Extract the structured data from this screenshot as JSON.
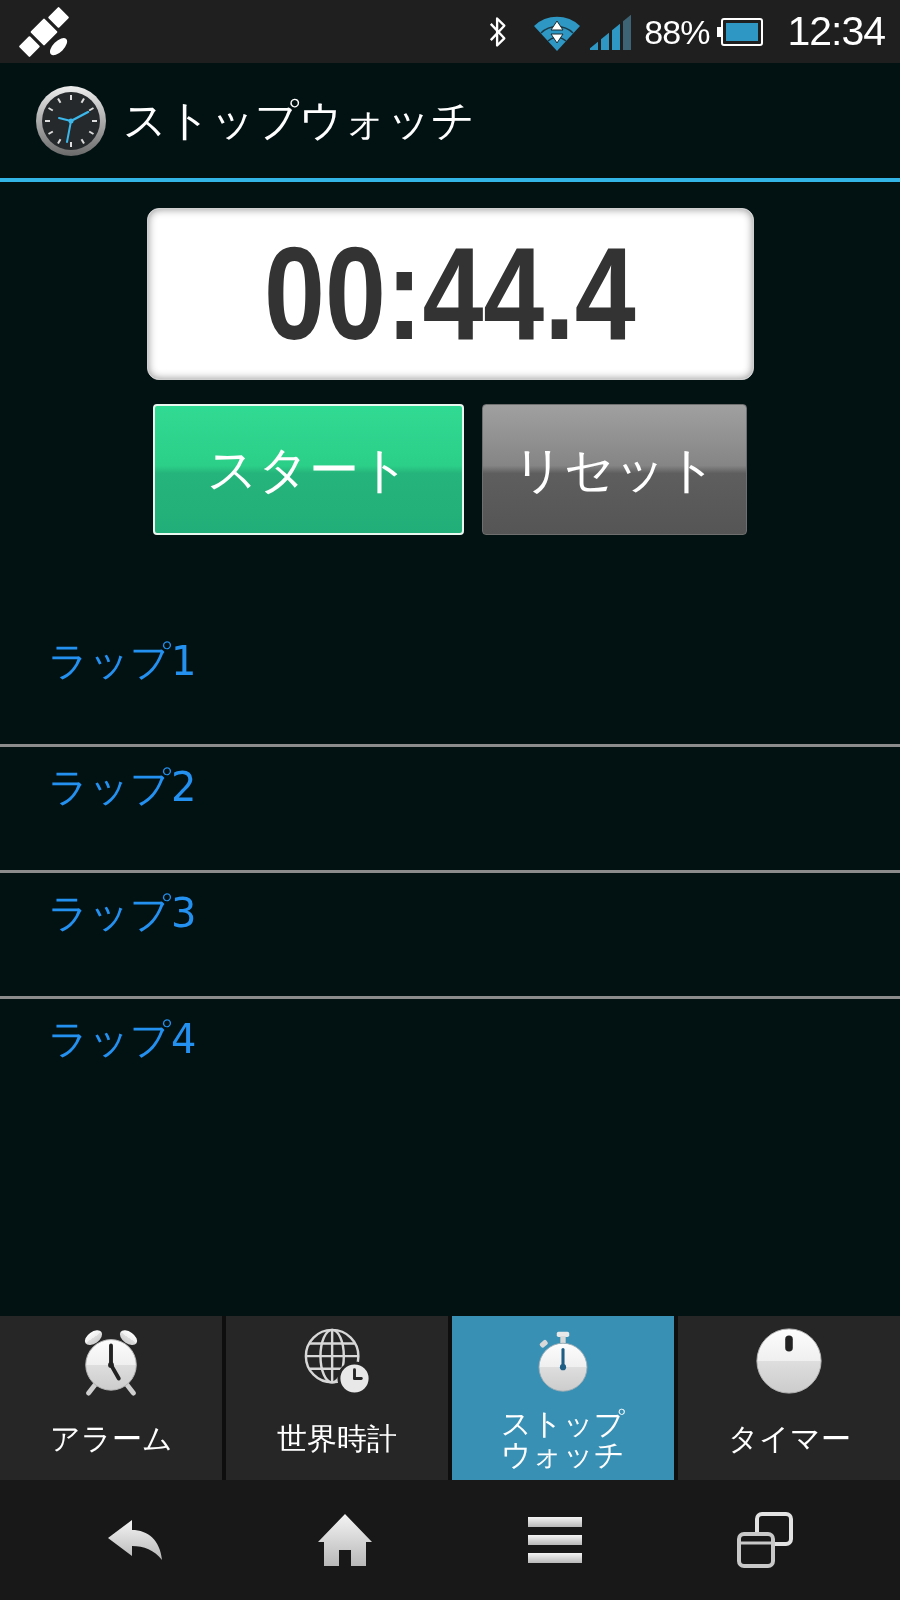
{
  "status_bar": {
    "battery": "88%",
    "time": "12:34"
  },
  "header": {
    "title": "ストップウォッチ"
  },
  "stopwatch": {
    "display": "00:44.4",
    "buttons": [
      {
        "label": "スタート",
        "kind": "start"
      },
      {
        "label": "リセット",
        "kind": "reset"
      }
    ]
  },
  "laps": [
    {
      "label": "ラップ1"
    },
    {
      "label": "ラップ2"
    },
    {
      "label": "ラップ3"
    },
    {
      "label": "ラップ4"
    }
  ],
  "tabs": [
    {
      "label": "アラーム",
      "selected": false
    },
    {
      "label": "世界時計",
      "selected": false
    },
    {
      "label": "ストップウォッチ",
      "selected": true
    },
    {
      "label": "タイマー",
      "selected": false
    }
  ]
}
